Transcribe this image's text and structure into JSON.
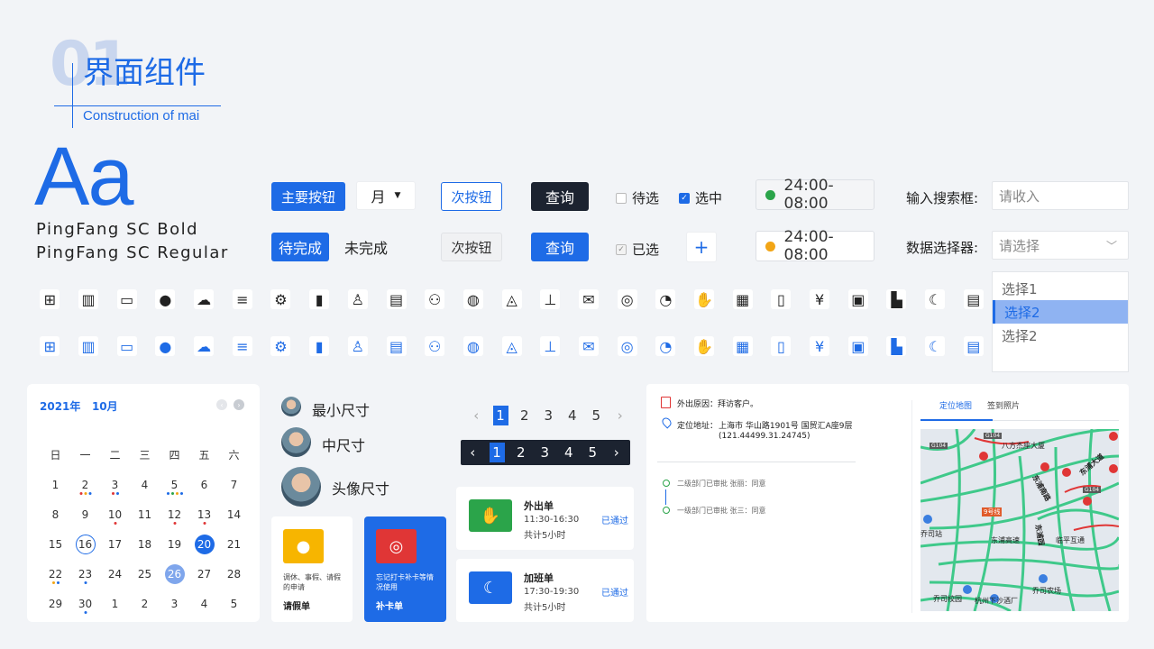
{
  "header": {
    "big": "01",
    "title": "界面组件",
    "subtitle": "Construction of mai"
  },
  "typo": {
    "sample": "Aa",
    "font1": "PingFang SC Bold",
    "font2": "PingFang SC Regular"
  },
  "buttons": {
    "primary": "主要按钮",
    "month": "月",
    "secondary": "次按钮",
    "query": "查询",
    "pending": "待完成",
    "unfinished": "未完成",
    "secondary2": "次按钮",
    "query2": "查询",
    "plus": "+"
  },
  "checks": {
    "unselected": "待选",
    "selected": "选中",
    "done": "已选"
  },
  "time": {
    "t1": "24:00-08:00",
    "t2": "24:00-08:00",
    "c1": "#2ba44a",
    "c2": "#f2a516"
  },
  "search": {
    "label": "输入搜索框:",
    "placeholder": "请收入",
    "selector_label": "数据选择器:",
    "selector_placeholder": "请选择"
  },
  "options": [
    "选择1",
    "选择2",
    "选择2"
  ],
  "calendar": {
    "year": "2021年",
    "month": "10月",
    "weekdays": [
      "日",
      "一",
      "二",
      "三",
      "四",
      "五",
      "六"
    ],
    "days": [
      "1",
      "2",
      "3",
      "4",
      "5",
      "6",
      "7",
      "8",
      "9",
      "10",
      "11",
      "12",
      "13",
      "14",
      "15",
      "16",
      "17",
      "18",
      "19",
      "20",
      "21",
      "22",
      "23",
      "24",
      "25",
      "26",
      "27",
      "28",
      "29",
      "30",
      "1",
      "2",
      "3",
      "4",
      "5"
    ]
  },
  "avatars": {
    "s": "最小尺寸",
    "m": "中尺寸",
    "l": "头像尺寸"
  },
  "pagination": [
    "1",
    "2",
    "3",
    "4",
    "5"
  ],
  "cards": {
    "leave_desc": "调休、事假、请假的申请",
    "leave_title": "请假单",
    "punch_desc": "忘记打卡补卡等情况使用",
    "punch_title": "补卡单",
    "out_title": "外出单",
    "out_time": "11:30-16:30",
    "out_total": "共计5小时",
    "out_status": "已通过",
    "ot_title": "加班单",
    "ot_time": "17:30-19:30",
    "ot_total": "共计5小时",
    "ot_status": "已通过"
  },
  "detail": {
    "reason": "外出原因：拜访客户。",
    "loc_label": "定位地址：",
    "loc_addr": "上海市 华山路1901号 国贸汇A座9层",
    "coords": "(121.44499.31.24745)",
    "step2": "二级部门已审批 张丽：同意",
    "step1": "一级部门已审批 张三：同意",
    "tab_map": "定位地图",
    "tab_photo": "签到照片"
  },
  "map_labels": {
    "a": "八方杰座大厦",
    "b": "东浦南路",
    "c": "东浦高速",
    "d": "东浦园",
    "e": "临平互通",
    "f": "东浦大道",
    "g": "乔司站",
    "h": "乔司农场",
    "i": "乔司校园",
    "j": "杭州下沙酒厂",
    "k": "9号线",
    "l": "G104",
    "m": "G104",
    "n": "G104",
    "o": "乔司站"
  },
  "colors": {
    "accent": "#1e6be6",
    "dark": "#1c2330",
    "green": "#2ba44a",
    "amber": "#f2a516",
    "red": "#e03636"
  }
}
